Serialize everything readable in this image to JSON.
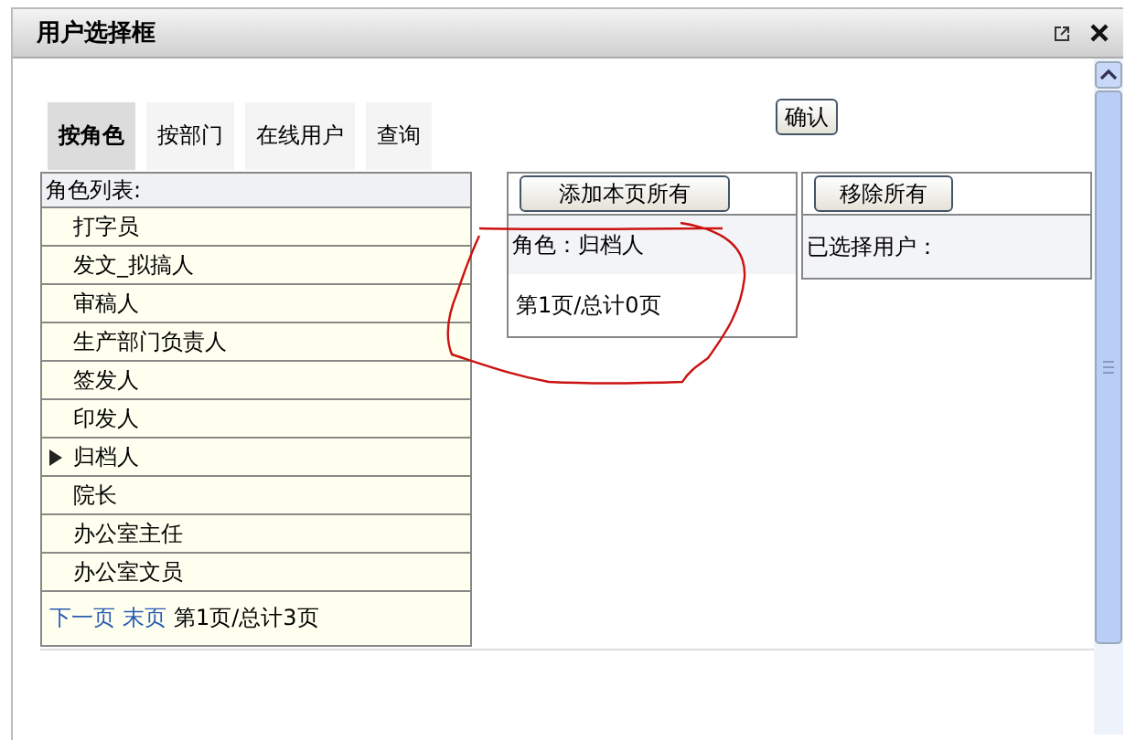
{
  "window": {
    "title": "用户选择框"
  },
  "tabs": [
    {
      "label": "按角色",
      "selected": true
    },
    {
      "label": "按部门",
      "selected": false
    },
    {
      "label": "在线用户",
      "selected": false
    },
    {
      "label": "查询",
      "selected": false
    }
  ],
  "confirm_button": "确认",
  "role_list": {
    "header": "角色列表:",
    "items": [
      {
        "label": "打字员",
        "selected": false
      },
      {
        "label": "发文_拟搞人",
        "selected": false
      },
      {
        "label": "审稿人",
        "selected": false
      },
      {
        "label": "生产部门负责人",
        "selected": false
      },
      {
        "label": "签发人",
        "selected": false
      },
      {
        "label": "印发人",
        "selected": false
      },
      {
        "label": "归档人",
        "selected": true
      },
      {
        "label": "院长",
        "selected": false
      },
      {
        "label": "办公室主任",
        "selected": false
      },
      {
        "label": "办公室文员",
        "selected": false
      }
    ],
    "pager": {
      "links": [
        "下一页",
        "末页"
      ],
      "status": "第1页/总计3页"
    }
  },
  "role_users": {
    "button": "添加本页所有",
    "role": "角色：归档人",
    "pager": "第1页/总计0页"
  },
  "selected_users": {
    "button": "移除所有",
    "label": "已选择用户："
  }
}
